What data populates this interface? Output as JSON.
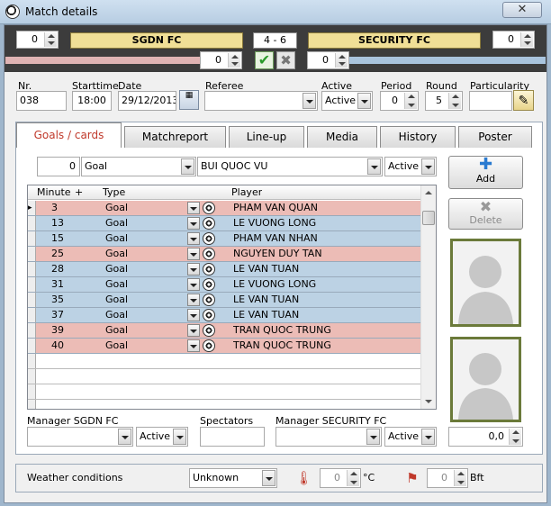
{
  "window": {
    "title": "Match details",
    "close_label": "✕"
  },
  "header": {
    "home_team": "SGDN FC",
    "away_team": "SECURITY FC",
    "score": "4  -  6",
    "home_spin": "0",
    "away_spin": "0",
    "home_spin2": "0",
    "away_spin2": "0"
  },
  "info": {
    "nr_label": "Nr.",
    "nr_value": "038",
    "starttime_label": "Starttime",
    "starttime_value": "18:00",
    "date_label": "Date",
    "date_value": "29/12/2013",
    "referee_label": "Referee",
    "referee_value": "",
    "active_label": "Active",
    "active_value": "Active",
    "period_label": "Period",
    "period_value": "0",
    "round_label": "Round",
    "round_value": "5",
    "particularity_label": "Particularity",
    "particularity_value": ""
  },
  "tabs": [
    "Goals / cards",
    "Matchreport",
    "Line-up",
    "Media",
    "History",
    "Poster"
  ],
  "filter": {
    "minute": "0",
    "type": "Goal",
    "player": "BUI QUOC VU",
    "status": "Active"
  },
  "grid": {
    "headers": {
      "minute": "Minute",
      "plus": "+",
      "type": "Type",
      "player": "Player"
    },
    "rows": [
      {
        "minute": "3",
        "type": "Goal",
        "player": "PHAM VAN QUAN",
        "team": "away"
      },
      {
        "minute": "13",
        "type": "Goal",
        "player": "LE VUONG LONG",
        "team": "home"
      },
      {
        "minute": "15",
        "type": "Goal",
        "player": "PHAM VAN NHAN",
        "team": "home"
      },
      {
        "minute": "25",
        "type": "Goal",
        "player": "NGUYEN DUY TAN",
        "team": "away"
      },
      {
        "minute": "28",
        "type": "Goal",
        "player": "LE VAN TUAN",
        "team": "home"
      },
      {
        "minute": "31",
        "type": "Goal",
        "player": "LE VUONG LONG",
        "team": "home"
      },
      {
        "minute": "35",
        "type": "Goal",
        "player": "LE VAN TUAN",
        "team": "home"
      },
      {
        "minute": "37",
        "type": "Goal",
        "player": "LE VAN TUAN",
        "team": "home"
      },
      {
        "minute": "39",
        "type": "Goal",
        "player": "TRAN QUOC TRUNG",
        "team": "away"
      },
      {
        "minute": "40",
        "type": "Goal",
        "player": "TRAN QUOC TRUNG",
        "team": "away"
      }
    ]
  },
  "buttons": {
    "add": "Add",
    "delete": "Delete"
  },
  "managers": {
    "home_label": "Manager SGDN FC",
    "home_value": "",
    "home_status": "Active",
    "spectators_label": "Spectators",
    "spectators_value": "",
    "away_label": "Manager SECURITY FC",
    "away_value": "",
    "away_status": "Active",
    "rating": "0,0"
  },
  "weather": {
    "label": "Weather conditions",
    "value": "Unknown",
    "temp": "0",
    "temp_unit": "°C",
    "wind": "0",
    "wind_unit": "Bft"
  },
  "colors": {
    "home_row": "#ecbcb6",
    "away_row": "#bcd2e4",
    "team_box": "#f0df96",
    "active_tab_text": "#c0392b"
  }
}
